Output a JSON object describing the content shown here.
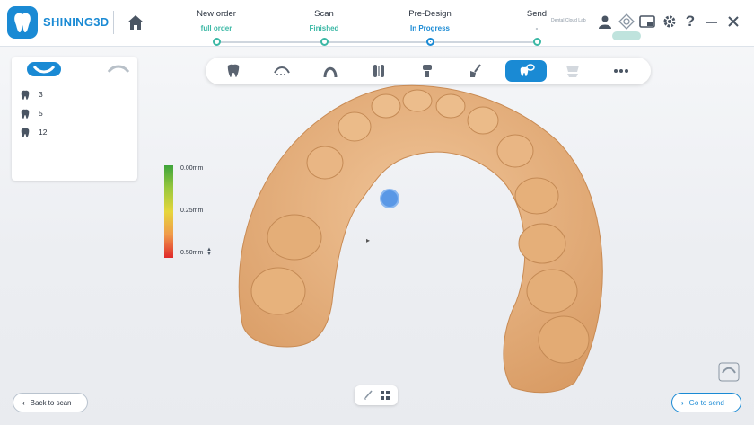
{
  "app": {
    "brand": "SHINING3D"
  },
  "steps": [
    {
      "title": "New order",
      "status": "full order",
      "color": "#3bb8a5"
    },
    {
      "title": "Scan",
      "status": "Finished",
      "color": "#3bb8a5"
    },
    {
      "title": "Pre-Design",
      "status": "In Progress",
      "color": "#1a8ad4"
    },
    {
      "title": "Send",
      "status": "-",
      "color": "#3bb8a5"
    }
  ],
  "top_right": {
    "lab_name": "Dental Cloud Lab"
  },
  "left_panel": {
    "teeth": [
      {
        "number": "3"
      },
      {
        "number": "5"
      },
      {
        "number": "12"
      }
    ]
  },
  "scale": {
    "top": "0.00mm",
    "mid": "0.25mm",
    "bottom": "0.50mm"
  },
  "buttons": {
    "back": "Back to scan",
    "send": "Go to send"
  },
  "icons": {
    "home": "home-icon",
    "user": "user-icon",
    "settings": "gear-icon",
    "help": "help-icon",
    "minimize": "minimize-icon",
    "close": "close-icon"
  },
  "colors": {
    "accent": "#1a8ad4",
    "done": "#3bb8a5",
    "model": "#e8b988"
  }
}
